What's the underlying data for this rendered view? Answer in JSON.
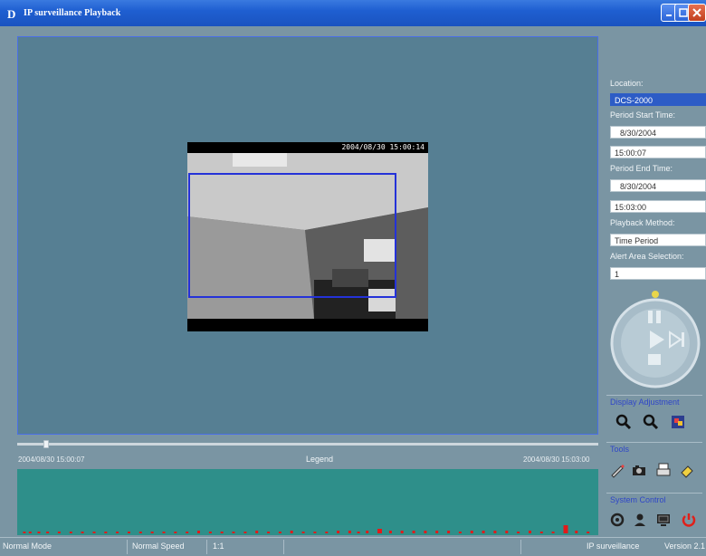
{
  "window": {
    "title": "IP surveillance  Playback",
    "logo_letter": "D",
    "controls": [
      "minimize",
      "maximize",
      "close"
    ]
  },
  "video": {
    "timestamp": "2004/08/30 15:00:14",
    "alert_area_color": "#2432d8"
  },
  "timeline": {
    "start": "2004/08/30 15:00:07",
    "end": "2004/08/30 15:03:00",
    "legend_label": "Legend",
    "position_fraction": 0.05
  },
  "activity_chart": {
    "type": "bar",
    "background": "#2e8f8a",
    "bar_color": "#e21a1a",
    "x": [
      0.01,
      0.02,
      0.035,
      0.05,
      0.07,
      0.09,
      0.11,
      0.13,
      0.15,
      0.17,
      0.19,
      0.21,
      0.23,
      0.25,
      0.27,
      0.29,
      0.31,
      0.33,
      0.35,
      0.37,
      0.39,
      0.41,
      0.43,
      0.45,
      0.47,
      0.49,
      0.51,
      0.53,
      0.55,
      0.57,
      0.585,
      0.6,
      0.62,
      0.64,
      0.66,
      0.68,
      0.7,
      0.72,
      0.74,
      0.76,
      0.78,
      0.8,
      0.82,
      0.84,
      0.86,
      0.88,
      0.9,
      0.92,
      0.94,
      0.96,
      0.98
    ],
    "values": [
      2,
      2,
      2,
      2,
      2,
      2,
      2,
      2,
      2,
      2,
      2,
      2,
      2,
      2,
      2,
      2,
      3,
      2,
      2,
      2,
      2,
      3,
      2,
      2,
      3,
      2,
      2,
      2,
      3,
      3,
      2,
      3,
      5,
      3,
      3,
      3,
      3,
      3,
      3,
      2,
      3,
      3,
      3,
      3,
      2,
      3,
      2,
      2,
      9,
      3,
      2
    ]
  },
  "right_panel": {
    "location_label": "Location:",
    "location_value": "DCS-2000",
    "start_label": "Period Start Time:",
    "start_date": "8/30/2004",
    "start_time": "15:00:07",
    "end_label": "Period End Time:",
    "end_date": "8/30/2004",
    "end_time": "15:03:00",
    "method_label": "Playback Method:",
    "method_value": "Time Period",
    "alert_label": "Alert Area Selection:",
    "alert_value": "1"
  },
  "groups": {
    "display_adjustment": "Display Adjustment",
    "tools": "Tools",
    "system_control": "System Control"
  },
  "status": {
    "mode": "Normal Mode",
    "speed": "Normal Speed",
    "ratio": "1:1",
    "product": "IP surveillance",
    "version": "Version 2.1"
  },
  "colors": {
    "accent": "#2f46c8",
    "panel": "#567f93",
    "background": "#7a95a3"
  }
}
